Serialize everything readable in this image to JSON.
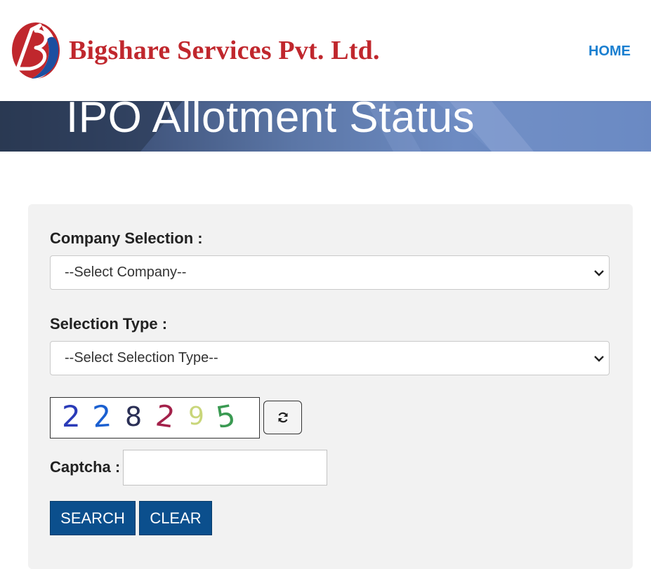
{
  "header": {
    "logo_text": "Bigshare Services Pvt. Ltd.",
    "logo_mark_letter": "B",
    "nav_home": "HOME"
  },
  "banner": {
    "title": "IPO Allotment Status"
  },
  "form": {
    "company_label": "Company Selection :",
    "company_select_value": "--Select Company--",
    "type_label": "Selection Type :",
    "type_select_value": "--Select Selection Type--",
    "captcha_digits": [
      {
        "char": "2",
        "color": "#2a3bb8"
      },
      {
        "char": "2",
        "color": "#1a5fd0"
      },
      {
        "char": "8",
        "color": "#2a2f55"
      },
      {
        "char": "2",
        "color": "#a3214a"
      },
      {
        "char": "9",
        "color": "#c9d67a"
      },
      {
        "char": "5",
        "color": "#3a9a52"
      }
    ],
    "captcha_label": "Captcha :",
    "captcha_input_value": "",
    "search_label": "SEARCH",
    "clear_label": "CLEAR"
  },
  "colors": {
    "brand_red": "#c0272d",
    "link_blue": "#1a7fd0",
    "button_blue": "#0b4f8d"
  },
  "icons": {
    "refresh": "refresh-icon",
    "chevron": "chevron-down-icon"
  }
}
